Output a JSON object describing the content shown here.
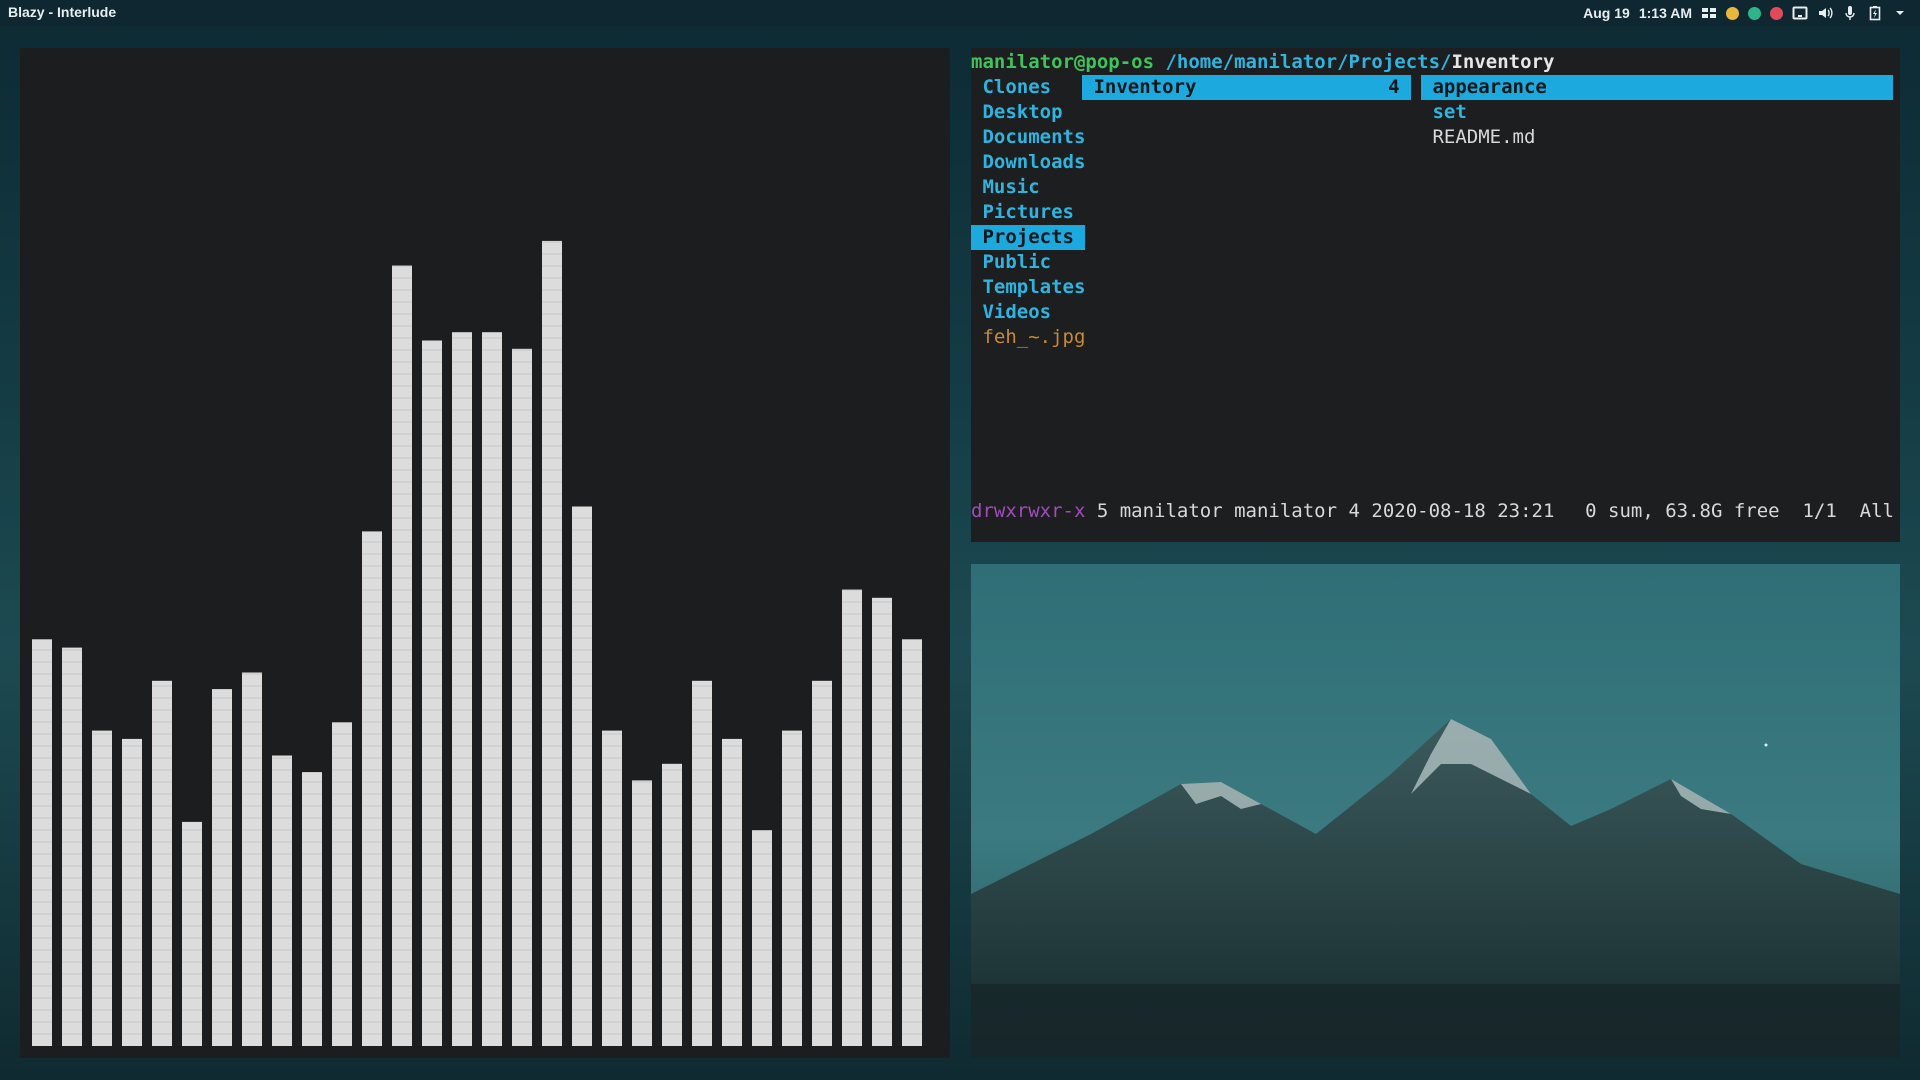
{
  "topbar": {
    "title": "Blazy - Interlude",
    "date": "Aug 19",
    "time": "1:13 AM",
    "status_colors": [
      "#e9b83a",
      "#2fb48a",
      "#e24a5a"
    ],
    "icons": [
      "grid-icon",
      "tablet-icon",
      "volume-icon",
      "microphone-icon",
      "battery-icon",
      "chevron-down-icon"
    ]
  },
  "visualizer": {
    "bar_color": "#dcdcdc",
    "bars": [
      0.49,
      0.48,
      0.38,
      0.37,
      0.44,
      0.27,
      0.43,
      0.45,
      0.35,
      0.33,
      0.39,
      0.62,
      0.94,
      0.85,
      0.86,
      0.86,
      0.84,
      0.97,
      0.65,
      0.38,
      0.32,
      0.34,
      0.44,
      0.37,
      0.26,
      0.38,
      0.44,
      0.55,
      0.54,
      0.49
    ]
  },
  "terminal": {
    "prompt_user": "manilator@pop-os",
    "prompt_path": "/home/manilator/Projects/",
    "prompt_current": "Inventory",
    "left_column": [
      {
        "name": "Clones",
        "type": "dir"
      },
      {
        "name": "Desktop",
        "type": "dir"
      },
      {
        "name": "Documents",
        "type": "dir"
      },
      {
        "name": "Downloads",
        "type": "dir"
      },
      {
        "name": "Music",
        "type": "dir"
      },
      {
        "name": "Pictures",
        "type": "dir"
      },
      {
        "name": "Projects",
        "type": "dir",
        "selected": true
      },
      {
        "name": "Public",
        "type": "dir"
      },
      {
        "name": "Templates",
        "type": "dir"
      },
      {
        "name": "Videos",
        "type": "dir"
      },
      {
        "name": "feh_~.jpg",
        "type": "image"
      }
    ],
    "middle_column": [
      {
        "name": "Inventory",
        "count": "4",
        "selected": true
      }
    ],
    "right_column": [
      {
        "name": "appearance",
        "type": "dir",
        "selected": true
      },
      {
        "name": "set",
        "type": "dir"
      },
      {
        "name": "README.md",
        "type": "file"
      }
    ],
    "status": {
      "permissions": "drwxrwxr-x",
      "info": "5 manilator manilator 4 2020-08-18 23:21",
      "summary": "0 sum, 63.8G free  1/1  All"
    }
  },
  "wallpaper": {
    "description_icon": "mountain-icon"
  }
}
